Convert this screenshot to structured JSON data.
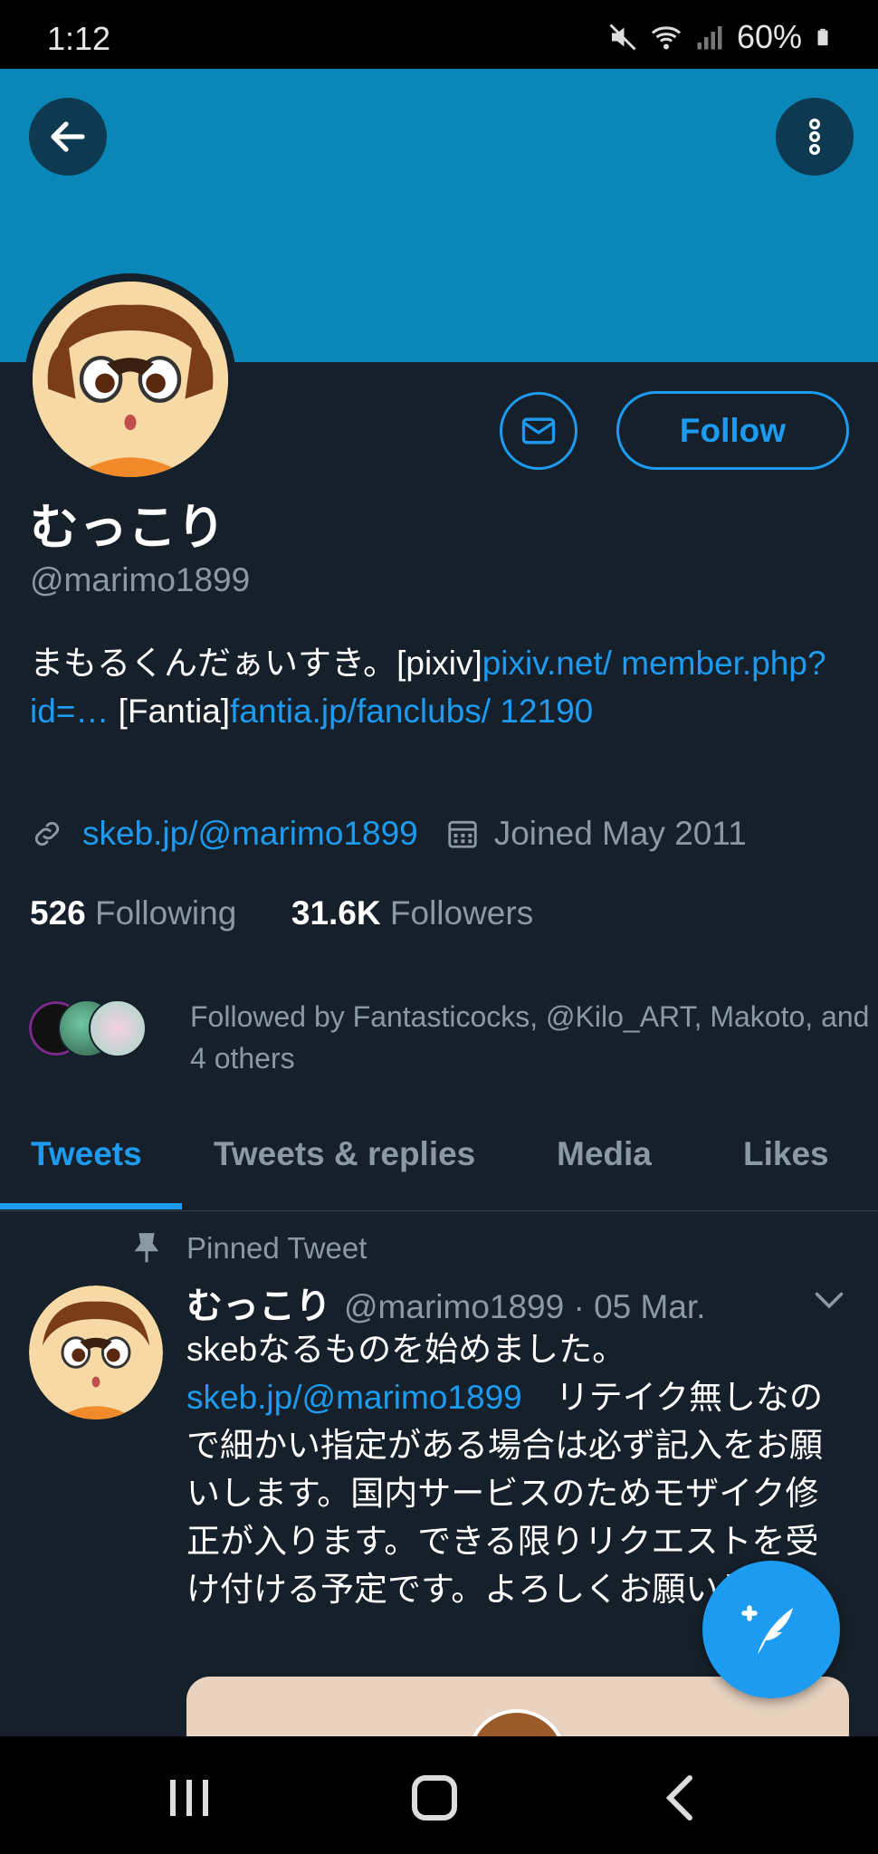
{
  "status_bar": {
    "time": "1:12",
    "battery": "60%"
  },
  "profile": {
    "name": "むっこり",
    "handle": "@marimo1899",
    "follow_label": "Follow",
    "bio_part1": "まもるくんだぁいすき。[pixiv]",
    "bio_link1": "pixiv.net/ member.php?id=…",
    "bio_part2": " [Fantia]",
    "bio_link2": "fantia.jp/fanclubs/ 12190",
    "website": "skeb.jp/@marimo1899",
    "joined": "Joined May 2011",
    "following_count": "526",
    "following_label": "Following",
    "followers_count": "31.6K",
    "followers_label": "Followers",
    "followed_by": "Followed by Fantasticocks, @Kilo_ART, Makoto, and 4 others"
  },
  "tabs": [
    {
      "label": "Tweets",
      "active": true
    },
    {
      "label": "Tweets & replies",
      "active": false
    },
    {
      "label": "Media",
      "active": false
    },
    {
      "label": "Likes",
      "active": false
    }
  ],
  "tweet": {
    "pinned_label": "Pinned Tweet",
    "name": "むっこり",
    "handle_date": "@marimo1899 · 05 Mar.",
    "line1": "skebなるものを始めました。",
    "link": "skeb.jp/@marimo1899",
    "rest": "　リテイク無しなので細かい指定がある場合は必ず記入をお願いします。国内サービスのためモザイク修正が入ります。できる限りリクエストを受け付ける予定です。よろしくお願いします。"
  },
  "colors": {
    "background": "#15202b",
    "banner": "#0a87b8",
    "accent": "#1d9bf0",
    "muted_text": "#8b98a5"
  },
  "icons": [
    "back-arrow-icon",
    "more-vertical-icon",
    "mail-icon",
    "link-icon",
    "calendar-icon",
    "pin-icon",
    "chevron-down-icon",
    "compose-icon",
    "recents-icon",
    "home-icon",
    "back-icon"
  ]
}
